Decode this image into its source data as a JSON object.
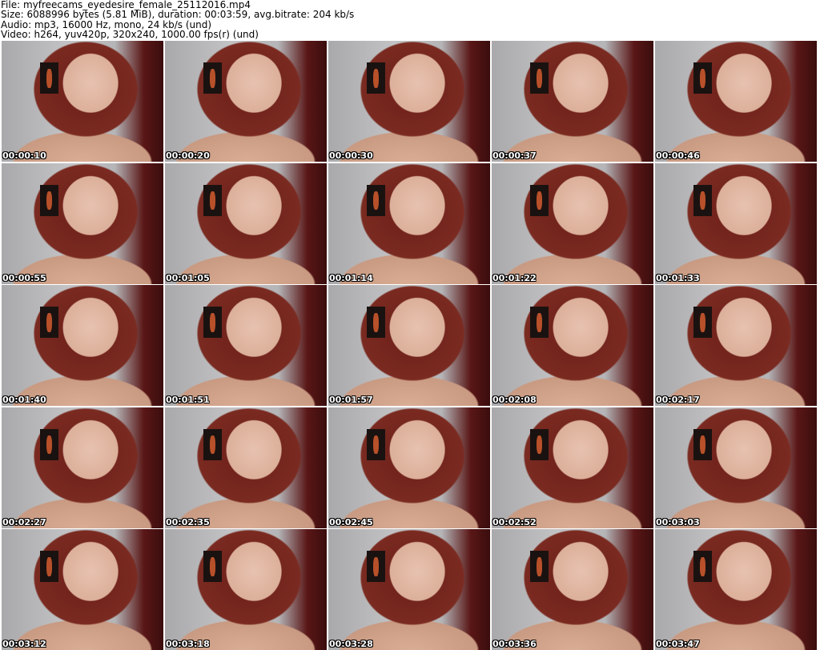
{
  "header": {
    "file": "File: myfreecams_eyedesire_female_25112016.mp4",
    "size": "Size: 6088996 bytes (5.81 MiB), duration: 00:03:59, avg.bitrate: 204 kb/s",
    "audio": "Audio: mp3, 16000 Hz, mono, 24 kb/s (und)",
    "video": "Video: h264, yuv420p, 320x240, 1000.00 fps(r) (und)"
  },
  "timestamps": [
    "00:00:10",
    "00:00:20",
    "00:00:30",
    "00:00:37",
    "00:00:46",
    "00:00:55",
    "00:01:05",
    "00:01:14",
    "00:01:22",
    "00:01:33",
    "00:01:40",
    "00:01:51",
    "00:01:57",
    "00:02:08",
    "00:02:17",
    "00:02:27",
    "00:02:35",
    "00:02:45",
    "00:02:52",
    "00:03:03",
    "00:03:12",
    "00:03:18",
    "00:03:28",
    "00:03:36",
    "00:03:47"
  ]
}
